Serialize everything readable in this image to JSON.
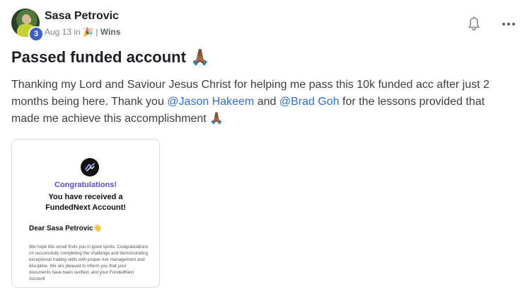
{
  "post": {
    "author": "Sasa Petrovic",
    "level": "3",
    "date": "Aug 13",
    "in_label": "in",
    "category_emoji": "🎉",
    "separator": "|",
    "category": "Wins",
    "title": "Passed funded account 🙏🏾",
    "body_parts": [
      "Thanking my Lord and Saviour Jesus Christ for helping me pass this 10k funded acc after just 2 months being here. Thank you ",
      "@Jason Hakeem",
      " and ",
      "@Brad Goh",
      " for the lessons provided that made me achieve this accomplishment 🙏🏾"
    ]
  },
  "icons": {
    "bell": "bell-icon",
    "more": "more-horizontal-icon",
    "logo": "fundednext-logo-icon"
  },
  "attachment": {
    "congrats": "Congratulations!",
    "received": "You have received a FundedNext Account!",
    "dear": "Dear Sasa Petrovic👋",
    "email_body": "We hope this email finds you in good spirits. Congratulations on successfully completing the challenge and demonstrating exceptional trading skills with proper risk management and discipline. We are pleased to inform you that your documents have been verified, and your FundedNext Account"
  },
  "colors": {
    "mention": "#2f6fdc",
    "badge": "#3c5fc8",
    "congrats": "#5b4fd6"
  }
}
